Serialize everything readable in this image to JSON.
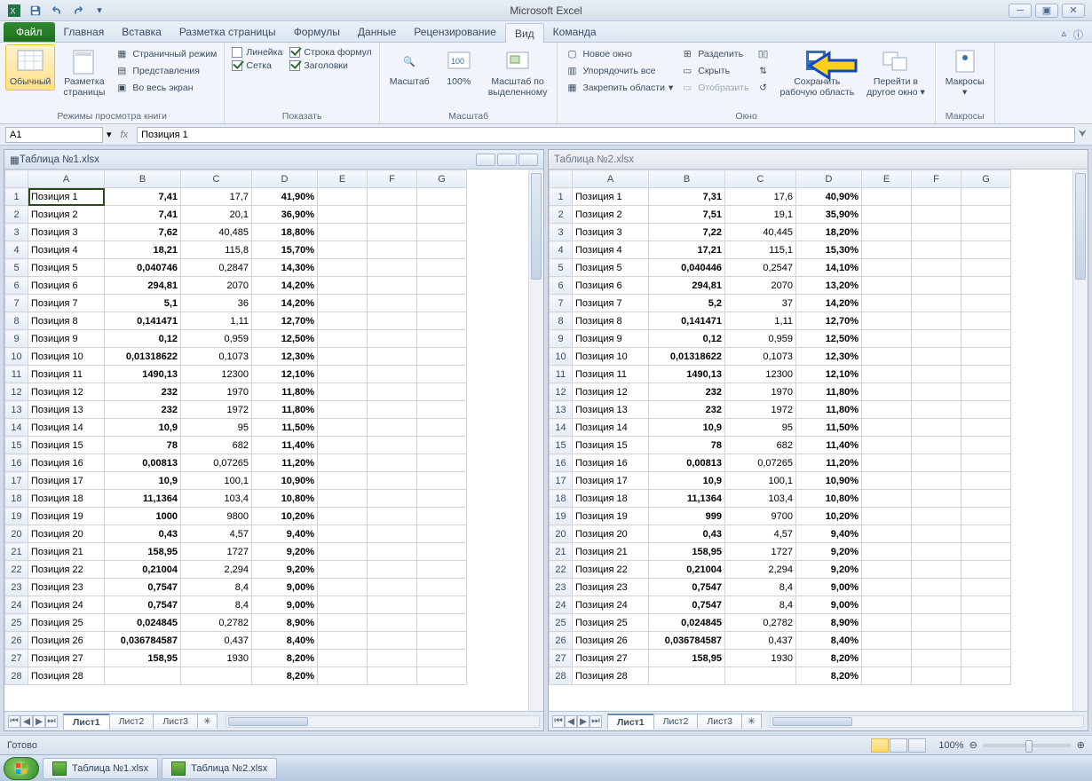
{
  "app_title": "Microsoft Excel",
  "qat": {
    "save": "save",
    "undo": "undo",
    "redo": "redo"
  },
  "tabs": {
    "file": "Файл",
    "items": [
      "Главная",
      "Вставка",
      "Разметка страницы",
      "Формулы",
      "Данные",
      "Рецензирование",
      "Вид",
      "Команда"
    ],
    "active": "Вид"
  },
  "ribbon": {
    "group1": {
      "label": "Режимы просмотра книги",
      "normal": "Обычный",
      "page_layout": "Разметка\nстраницы",
      "page_break": "Страничный режим",
      "custom_views": "Представления",
      "full_screen": "Во весь экран"
    },
    "group2": {
      "label": "Показать",
      "ruler": "Линейка",
      "gridlines": "Сетка",
      "formula_bar": "Строка формул",
      "headings": "Заголовки"
    },
    "group3": {
      "label": "Масштаб",
      "zoom": "Масштаб",
      "hundred": "100%",
      "zoom_sel": "Масштаб по\nвыделенному"
    },
    "group4": {
      "label": "Окно",
      "new_win": "Новое окно",
      "arrange": "Упорядочить все",
      "freeze": "Закрепить области",
      "split": "Разделить",
      "hide": "Скрыть",
      "unhide": "Отобразить",
      "save_workspace": "Сохранить\nрабочую область",
      "switch_win": "Перейти в\nдругое окно"
    },
    "group5": {
      "label": "Макросы",
      "macros": "Макросы"
    }
  },
  "formula_bar": {
    "name_box": "A1",
    "formula": "Позиция 1"
  },
  "windows": [
    {
      "title": "Таблица №1.xlsx",
      "active": true
    },
    {
      "title": "Таблица №2.xlsx",
      "active": false
    }
  ],
  "columns": [
    "A",
    "B",
    "C",
    "D",
    "E",
    "F",
    "G"
  ],
  "sheet_tabs": [
    "Лист1",
    "Лист2",
    "Лист3"
  ],
  "active_sheet": "Лист1",
  "status": {
    "ready": "Готово",
    "zoom": "100%"
  },
  "taskbar": {
    "btn1": "Таблица №1.xlsx",
    "btn2": "Таблица №2.xlsx"
  },
  "data1": [
    [
      "Позиция 1",
      "7,41",
      "17,7",
      "41,90%"
    ],
    [
      "Позиция 2",
      "7,41",
      "20,1",
      "36,90%"
    ],
    [
      "Позиция 3",
      "7,62",
      "40,485",
      "18,80%"
    ],
    [
      "Позиция 4",
      "18,21",
      "115,8",
      "15,70%"
    ],
    [
      "Позиция 5",
      "0,040746",
      "0,2847",
      "14,30%"
    ],
    [
      "Позиция 6",
      "294,81",
      "2070",
      "14,20%"
    ],
    [
      "Позиция 7",
      "5,1",
      "36",
      "14,20%"
    ],
    [
      "Позиция 8",
      "0,141471",
      "1,11",
      "12,70%"
    ],
    [
      "Позиция 9",
      "0,12",
      "0,959",
      "12,50%"
    ],
    [
      "Позиция 10",
      "0,01318622",
      "0,1073",
      "12,30%"
    ],
    [
      "Позиция 11",
      "1490,13",
      "12300",
      "12,10%"
    ],
    [
      "Позиция 12",
      "232",
      "1970",
      "11,80%"
    ],
    [
      "Позиция 13",
      "232",
      "1972",
      "11,80%"
    ],
    [
      "Позиция 14",
      "10,9",
      "95",
      "11,50%"
    ],
    [
      "Позиция 15",
      "78",
      "682",
      "11,40%"
    ],
    [
      "Позиция 16",
      "0,00813",
      "0,07265",
      "11,20%"
    ],
    [
      "Позиция 17",
      "10,9",
      "100,1",
      "10,90%"
    ],
    [
      "Позиция 18",
      "11,1364",
      "103,4",
      "10,80%"
    ],
    [
      "Позиция 19",
      "1000",
      "9800",
      "10,20%"
    ],
    [
      "Позиция 20",
      "0,43",
      "4,57",
      "9,40%"
    ],
    [
      "Позиция 21",
      "158,95",
      "1727",
      "9,20%"
    ],
    [
      "Позиция 22",
      "0,21004",
      "2,294",
      "9,20%"
    ],
    [
      "Позиция 23",
      "0,7547",
      "8,4",
      "9,00%"
    ],
    [
      "Позиция 24",
      "0,7547",
      "8,4",
      "9,00%"
    ],
    [
      "Позиция 25",
      "0,024845",
      "0,2782",
      "8,90%"
    ],
    [
      "Позиция 26",
      "0,036784587",
      "0,437",
      "8,40%"
    ],
    [
      "Позиция 27",
      "158,95",
      "1930",
      "8,20%"
    ],
    [
      "Позиция 28",
      "",
      "",
      "8,20%"
    ]
  ],
  "data2": [
    [
      "Позиция 1",
      "7,31",
      "17,6",
      "40,90%"
    ],
    [
      "Позиция 2",
      "7,51",
      "19,1",
      "35,90%"
    ],
    [
      "Позиция 3",
      "7,22",
      "40,445",
      "18,20%"
    ],
    [
      "Позиция 4",
      "17,21",
      "115,1",
      "15,30%"
    ],
    [
      "Позиция 5",
      "0,040446",
      "0,2547",
      "14,10%"
    ],
    [
      "Позиция 6",
      "294,81",
      "2070",
      "13,20%"
    ],
    [
      "Позиция 7",
      "5,2",
      "37",
      "14,20%"
    ],
    [
      "Позиция 8",
      "0,141471",
      "1,11",
      "12,70%"
    ],
    [
      "Позиция 9",
      "0,12",
      "0,959",
      "12,50%"
    ],
    [
      "Позиция 10",
      "0,01318622",
      "0,1073",
      "12,30%"
    ],
    [
      "Позиция 11",
      "1490,13",
      "12300",
      "12,10%"
    ],
    [
      "Позиция 12",
      "232",
      "1970",
      "11,80%"
    ],
    [
      "Позиция 13",
      "232",
      "1972",
      "11,80%"
    ],
    [
      "Позиция 14",
      "10,9",
      "95",
      "11,50%"
    ],
    [
      "Позиция 15",
      "78",
      "682",
      "11,40%"
    ],
    [
      "Позиция 16",
      "0,00813",
      "0,07265",
      "11,20%"
    ],
    [
      "Позиция 17",
      "10,9",
      "100,1",
      "10,90%"
    ],
    [
      "Позиция 18",
      "11,1364",
      "103,4",
      "10,80%"
    ],
    [
      "Позиция 19",
      "999",
      "9700",
      "10,20%"
    ],
    [
      "Позиция 20",
      "0,43",
      "4,57",
      "9,40%"
    ],
    [
      "Позиция 21",
      "158,95",
      "1727",
      "9,20%"
    ],
    [
      "Позиция 22",
      "0,21004",
      "2,294",
      "9,20%"
    ],
    [
      "Позиция 23",
      "0,7547",
      "8,4",
      "9,00%"
    ],
    [
      "Позиция 24",
      "0,7547",
      "8,4",
      "9,00%"
    ],
    [
      "Позиция 25",
      "0,024845",
      "0,2782",
      "8,90%"
    ],
    [
      "Позиция 26",
      "0,036784587",
      "0,437",
      "8,40%"
    ],
    [
      "Позиция 27",
      "158,95",
      "1930",
      "8,20%"
    ],
    [
      "Позиция 28",
      "",
      "",
      "8,20%"
    ]
  ]
}
